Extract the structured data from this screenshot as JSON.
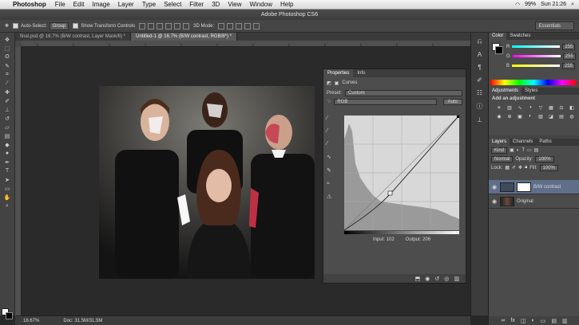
{
  "menubar": {
    "app_name": "Photoshop",
    "items": [
      "File",
      "Edit",
      "Image",
      "Layer",
      "Type",
      "Select",
      "Filter",
      "3D",
      "View",
      "Window",
      "Help"
    ],
    "battery": "99%",
    "clock": "Sun 21:26"
  },
  "window": {
    "title": "Adobe Photoshop CS6"
  },
  "options": {
    "auto_select_label": "Auto-Select:",
    "auto_select_value": "Group",
    "transform_label": "Show Transform Controls",
    "mode_3d_label": "3D Mode:",
    "workspace": "Essentials"
  },
  "tabs": [
    {
      "label": "final.psd @ 16.7% (B/W contrast, Layer Mask/8) *"
    },
    {
      "label": "Untitled-1 @ 16.7% (B/W contrast, RGB/8*) *"
    }
  ],
  "status": {
    "zoom": "16.67%",
    "doc": "Doc: 31.5M/31.5M"
  },
  "properties": {
    "tab_properties": "Properties",
    "tab_info": "Info",
    "title": "Curves",
    "preset_label": "Preset:",
    "preset_value": "Custom",
    "channel_value": "RGB",
    "auto_label": "Auto",
    "input_label": "Input: 102",
    "output_label": "Output: 206"
  },
  "color_panel": {
    "tab_color": "Color",
    "tab_swatches": "Swatches",
    "r_label": "R",
    "g_label": "G",
    "b_label": "B",
    "r_value": "255",
    "g_value": "255",
    "b_value": "255"
  },
  "adjustments_panel": {
    "tab_adjustments": "Adjustments",
    "tab_styles": "Styles",
    "header": "Add an adjustment"
  },
  "layers_panel": {
    "tab_layers": "Layers",
    "tab_channels": "Channels",
    "tab_paths": "Paths",
    "kind_label": "Kind",
    "blend_mode": "Normal",
    "opacity_label": "Opacity:",
    "opacity_value": "100%",
    "lock_label": "Lock:",
    "fill_label": "Fill:",
    "fill_value": "100%",
    "layers": [
      {
        "name": "B/W contrast"
      },
      {
        "name": "Original"
      }
    ]
  }
}
